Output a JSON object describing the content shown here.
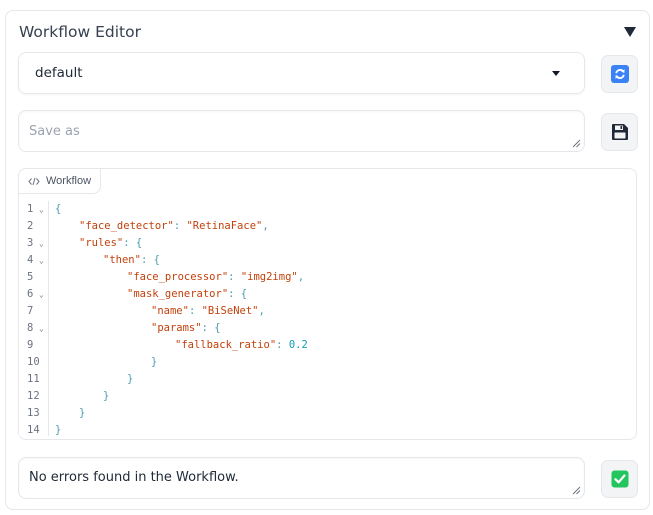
{
  "panel": {
    "title": "Workflow Editor"
  },
  "workflow_select": {
    "value": "default"
  },
  "save_as": {
    "placeholder": "Save as",
    "value": ""
  },
  "code": {
    "label": "Workflow",
    "lines": [
      {
        "n": "1",
        "fold": true,
        "indent": 0,
        "tokens": [
          [
            "p",
            "{"
          ]
        ]
      },
      {
        "n": "2",
        "fold": false,
        "indent": 1,
        "tokens": [
          [
            "k",
            "\"face_detector\""
          ],
          [
            "p",
            ": "
          ],
          [
            "s",
            "\"RetinaFace\""
          ],
          [
            "p",
            ","
          ]
        ]
      },
      {
        "n": "3",
        "fold": true,
        "indent": 1,
        "tokens": [
          [
            "k",
            "\"rules\""
          ],
          [
            "p",
            ": {"
          ]
        ]
      },
      {
        "n": "4",
        "fold": true,
        "indent": 2,
        "tokens": [
          [
            "k",
            "\"then\""
          ],
          [
            "p",
            ": {"
          ]
        ]
      },
      {
        "n": "5",
        "fold": false,
        "indent": 3,
        "tokens": [
          [
            "k",
            "\"face_processor\""
          ],
          [
            "p",
            ": "
          ],
          [
            "s",
            "\"img2img\""
          ],
          [
            "p",
            ","
          ]
        ]
      },
      {
        "n": "6",
        "fold": true,
        "indent": 3,
        "tokens": [
          [
            "k",
            "\"mask_generator\""
          ],
          [
            "p",
            ": {"
          ]
        ]
      },
      {
        "n": "7",
        "fold": false,
        "indent": 4,
        "tokens": [
          [
            "k",
            "\"name\""
          ],
          [
            "p",
            ": "
          ],
          [
            "s",
            "\"BiSeNet\""
          ],
          [
            "p",
            ","
          ]
        ]
      },
      {
        "n": "8",
        "fold": true,
        "indent": 4,
        "tokens": [
          [
            "k",
            "\"params\""
          ],
          [
            "p",
            ": {"
          ]
        ]
      },
      {
        "n": "9",
        "fold": false,
        "indent": 5,
        "tokens": [
          [
            "k",
            "\"fallback_ratio\""
          ],
          [
            "p",
            ": "
          ],
          [
            "n",
            "0.2"
          ]
        ]
      },
      {
        "n": "10",
        "fold": false,
        "indent": 4,
        "tokens": [
          [
            "p",
            "}"
          ]
        ]
      },
      {
        "n": "11",
        "fold": false,
        "indent": 3,
        "tokens": [
          [
            "p",
            "}"
          ]
        ]
      },
      {
        "n": "12",
        "fold": false,
        "indent": 2,
        "tokens": [
          [
            "p",
            "}"
          ]
        ]
      },
      {
        "n": "13",
        "fold": false,
        "indent": 1,
        "tokens": [
          [
            "p",
            "}"
          ]
        ]
      },
      {
        "n": "14",
        "fold": false,
        "indent": 0,
        "tokens": [
          [
            "p",
            "}"
          ]
        ]
      }
    ]
  },
  "status": {
    "message": "No errors found in the Workflow."
  },
  "colors": {
    "accent": "#3b82f6",
    "check_green": "#22c55e",
    "key": "#c2410c",
    "number": "#0e9fb3"
  },
  "icons": {
    "collapse": "triangle-down-icon",
    "refresh": "refresh-icon",
    "save": "floppy-disk-icon",
    "code": "code-icon",
    "check": "check-mark-icon"
  }
}
